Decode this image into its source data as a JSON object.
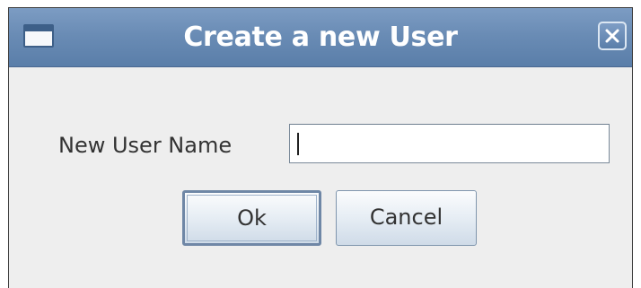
{
  "dialog": {
    "title": "Create a new User",
    "close_glyph": "✕"
  },
  "form": {
    "field_label": "New User Name",
    "field_value": "",
    "field_placeholder": ""
  },
  "buttons": {
    "ok_label": "Ok",
    "cancel_label": "Cancel"
  },
  "icons": {
    "window": "window-icon",
    "close": "close-icon"
  },
  "colors": {
    "titlebar": "#6a8cb5",
    "title_text": "#ffffff",
    "dialog_background": "#eeeeee",
    "button_border": "#7f95ad"
  }
}
